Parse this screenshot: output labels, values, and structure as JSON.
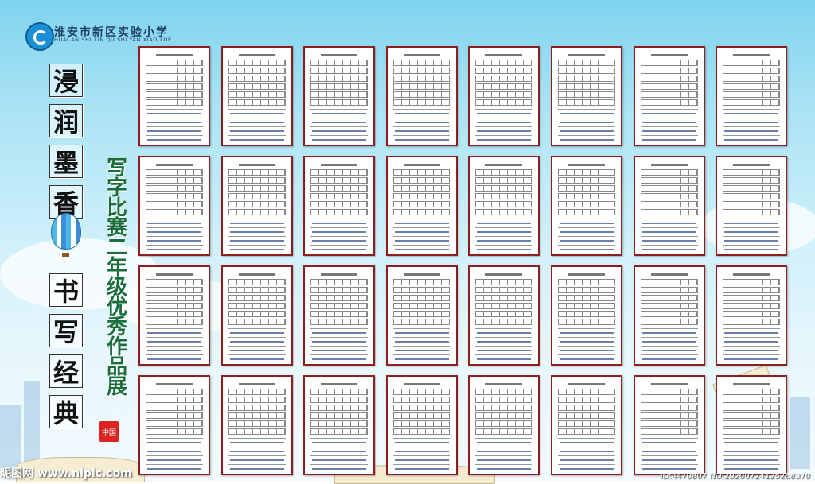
{
  "school": {
    "name_cn": "淮安市新区实验小学",
    "name_pinyin": "HUAI AN SHI XIN QU SHI YAN XIAO XUE"
  },
  "title_column_1": [
    "浸",
    "润",
    "墨",
    "香"
  ],
  "title_column_2": [
    "书",
    "写",
    "经",
    "典"
  ],
  "subtitle_chars": [
    "写",
    "字",
    "比",
    "赛",
    "二",
    "年",
    "级",
    "优",
    "秀",
    "作",
    "品",
    "展"
  ],
  "seal_text": "中国",
  "works": {
    "rows": 4,
    "cols": 8,
    "items": [
      {
        "row": 1,
        "col": 1
      },
      {
        "row": 1,
        "col": 2
      },
      {
        "row": 1,
        "col": 3
      },
      {
        "row": 1,
        "col": 4
      },
      {
        "row": 1,
        "col": 5
      },
      {
        "row": 1,
        "col": 6
      },
      {
        "row": 1,
        "col": 7
      },
      {
        "row": 1,
        "col": 8
      },
      {
        "row": 2,
        "col": 1
      },
      {
        "row": 2,
        "col": 2
      },
      {
        "row": 2,
        "col": 3
      },
      {
        "row": 2,
        "col": 4
      },
      {
        "row": 2,
        "col": 5
      },
      {
        "row": 2,
        "col": 6
      },
      {
        "row": 2,
        "col": 7
      },
      {
        "row": 2,
        "col": 8
      },
      {
        "row": 3,
        "col": 1
      },
      {
        "row": 3,
        "col": 2
      },
      {
        "row": 3,
        "col": 3
      },
      {
        "row": 3,
        "col": 4
      },
      {
        "row": 3,
        "col": 5
      },
      {
        "row": 3,
        "col": 6
      },
      {
        "row": 3,
        "col": 7
      },
      {
        "row": 3,
        "col": 8
      },
      {
        "row": 4,
        "col": 1
      },
      {
        "row": 4,
        "col": 2
      },
      {
        "row": 4,
        "col": 3
      },
      {
        "row": 4,
        "col": 4
      },
      {
        "row": 4,
        "col": 5
      },
      {
        "row": 4,
        "col": 6
      },
      {
        "row": 4,
        "col": 7
      },
      {
        "row": 4,
        "col": 8
      }
    ]
  },
  "watermark": {
    "site": "昵图网 www.nipic.com",
    "id": "ID:4470807 NO:20200724125268070"
  },
  "colors": {
    "card_border": "#8e1d1d",
    "subtitle": "#1a6e3b",
    "sky": "#7fd3ef"
  }
}
